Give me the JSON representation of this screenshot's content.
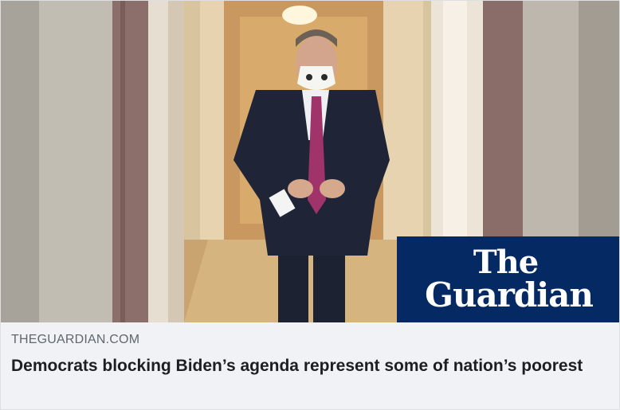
{
  "link_preview": {
    "image": {
      "description_icon": "photo-of-man-in-suit-and-mask-in-hallway",
      "brand_logo": {
        "line1": "The",
        "line2": "Guardian",
        "background": "#052962",
        "text_color": "#ffffff"
      }
    },
    "domain": "THEGUARDIAN.COM",
    "headline": "Democrats blocking Biden’s agenda represent some of nation’s poorest"
  }
}
